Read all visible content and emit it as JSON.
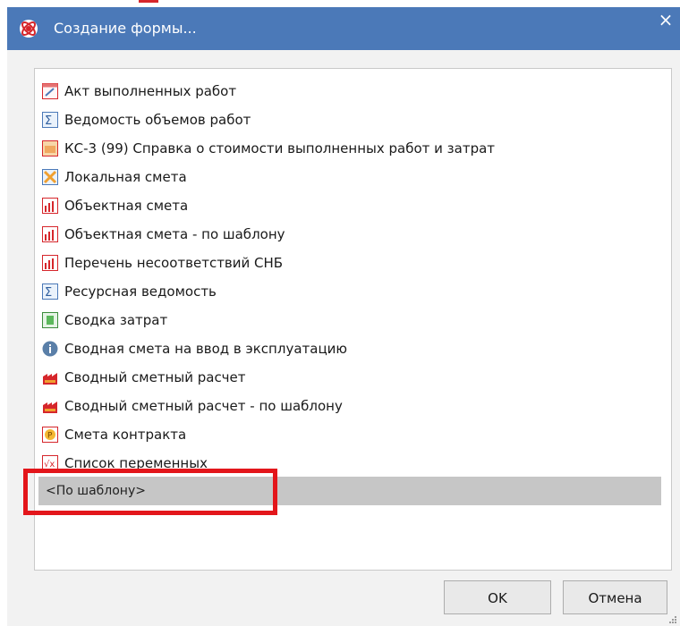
{
  "window": {
    "title": "Создание формы...",
    "close_label": "×",
    "accent": "#4b79b8"
  },
  "list": {
    "items": [
      {
        "label": "Акт выполненных работ",
        "icon": "act-document-icon"
      },
      {
        "label": "Ведомость объемов работ",
        "icon": "sigma-volume-icon"
      },
      {
        "label": "КС-3 (99) Справка о стоимости выполненных работ и затрат",
        "icon": "ks3-form-icon"
      },
      {
        "label": "Локальная смета",
        "icon": "local-estimate-icon"
      },
      {
        "label": "Объектная смета",
        "icon": "bar-chart-icon"
      },
      {
        "label": "Объектная смета - по шаблону",
        "icon": "bar-chart-icon"
      },
      {
        "label": "Перечень несоответствий СНБ",
        "icon": "bar-chart-icon"
      },
      {
        "label": "Ресурсная ведомость",
        "icon": "sigma-volume-icon"
      },
      {
        "label": "Сводка затрат",
        "icon": "cost-summary-icon"
      },
      {
        "label": "Сводная смета на ввод в эксплуатацию",
        "icon": "info-icon"
      },
      {
        "label": "Сводный сметный расчет",
        "icon": "factory-icon"
      },
      {
        "label": "Сводный сметный расчет - по шаблону",
        "icon": "factory-icon"
      },
      {
        "label": "Смета контракта",
        "icon": "coin-icon"
      },
      {
        "label": "Список переменных",
        "icon": "variables-icon"
      }
    ],
    "selected_template": "<По шаблону>"
  },
  "buttons": {
    "ok": "OK",
    "cancel": "Отмена"
  },
  "highlight_color": "#e3161b"
}
